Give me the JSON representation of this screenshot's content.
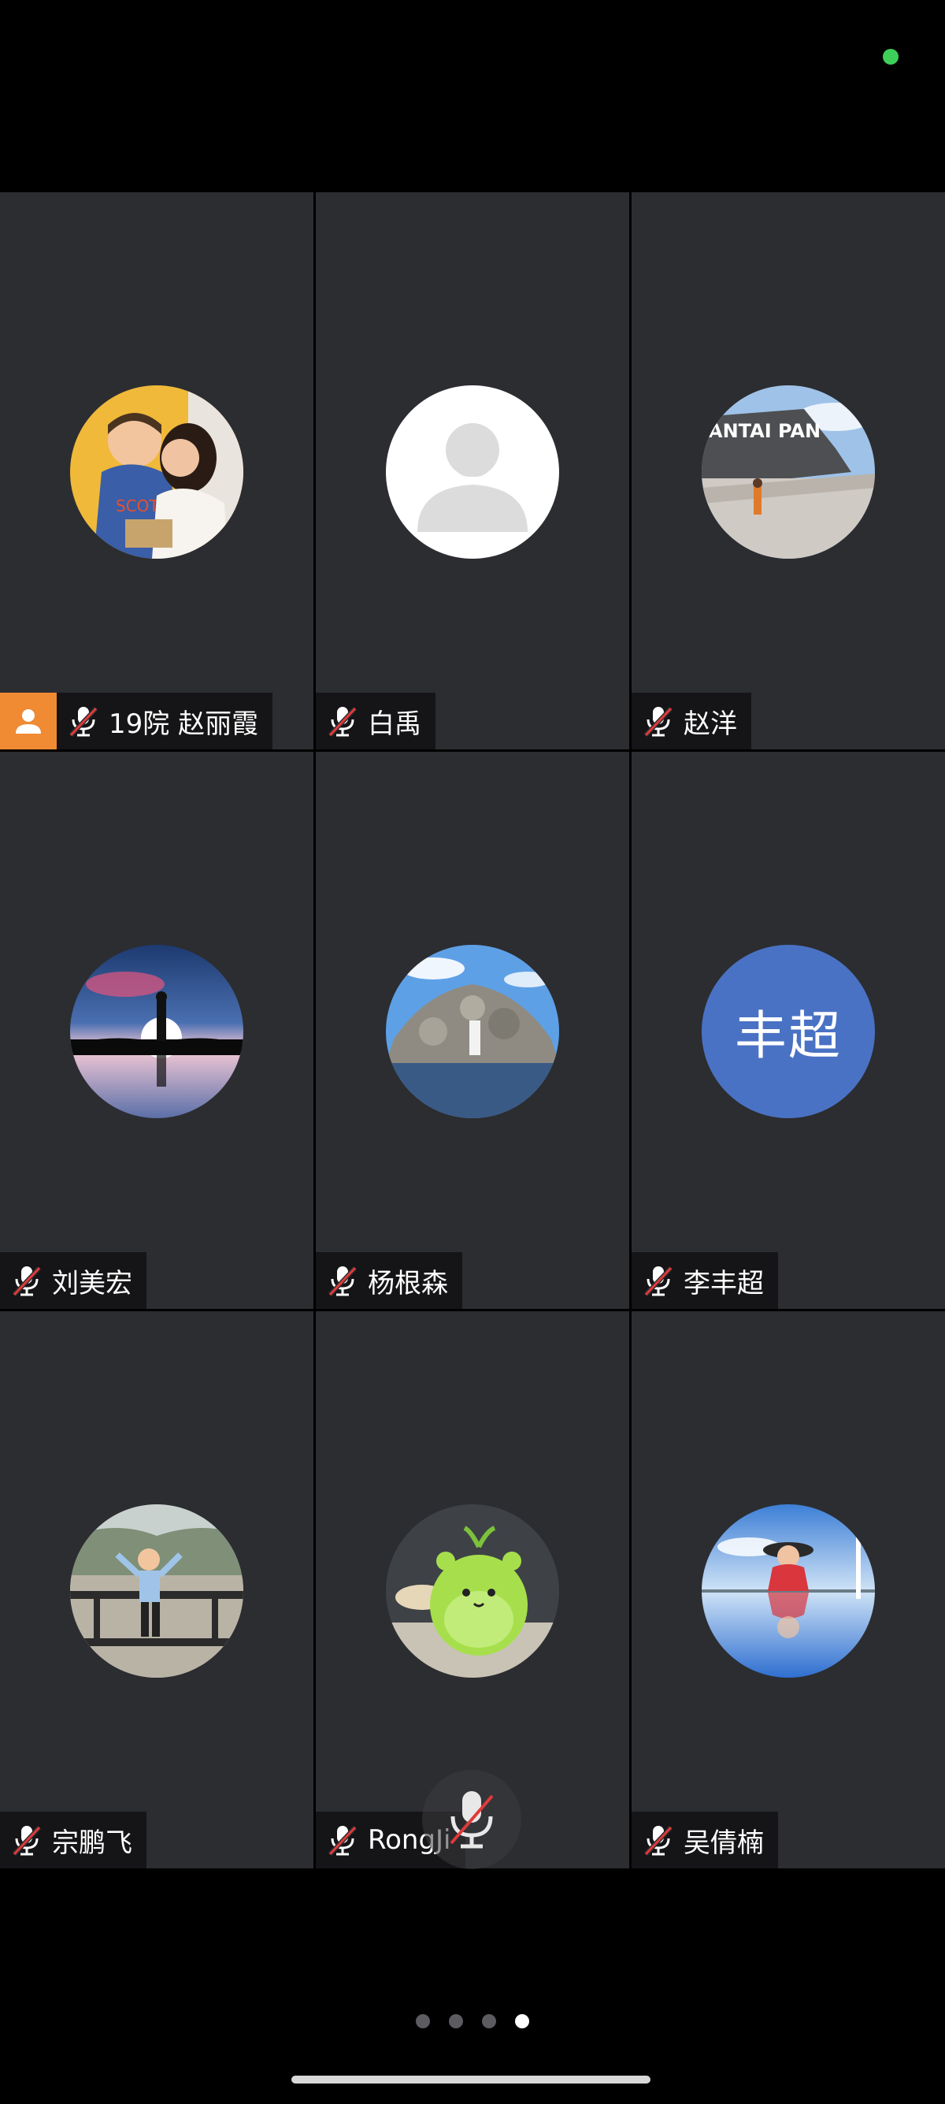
{
  "status": {
    "indicator_color": "#3ecf5a"
  },
  "participants": [
    {
      "name": "19院 赵丽霞",
      "muted": true,
      "host": true,
      "avatar": "photo-mother-child"
    },
    {
      "name": "白禹",
      "muted": true,
      "host": false,
      "avatar": "default-person"
    },
    {
      "name": "赵洋",
      "muted": true,
      "host": false,
      "avatar": "photo-coastal-road"
    },
    {
      "name": "刘美宏",
      "muted": true,
      "host": false,
      "avatar": "photo-silhouette-moon"
    },
    {
      "name": "杨根森",
      "muted": true,
      "host": false,
      "avatar": "photo-rock-pile"
    },
    {
      "name": "李丰超",
      "muted": true,
      "host": false,
      "avatar": "text",
      "avatar_text": "丰超",
      "avatar_color": "#4a72c4"
    },
    {
      "name": "宗鹏飞",
      "muted": true,
      "host": false,
      "avatar": "photo-child-arms-up"
    },
    {
      "name": "RongJi",
      "muted": true,
      "host": false,
      "avatar": "photo-green-plush"
    },
    {
      "name": "吴倩楠",
      "muted": true,
      "host": false,
      "avatar": "photo-woman-reflection"
    }
  ],
  "controls": {
    "microphone_muted": true
  },
  "pagination": {
    "pages": 4,
    "current": 4
  },
  "colors": {
    "tile_bg": "#2c2d31",
    "host_badge": "#f08a33",
    "mute_slash": "#e03a3a"
  }
}
